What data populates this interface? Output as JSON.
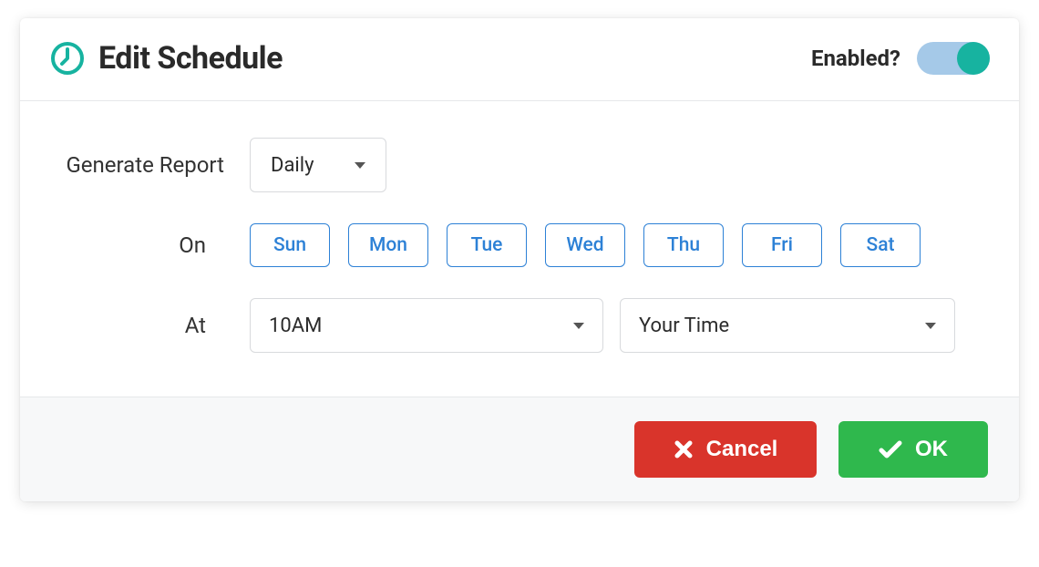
{
  "header": {
    "title": "Edit Schedule",
    "enabled_label": "Enabled?",
    "enabled": true
  },
  "body": {
    "generate_label": "Generate Report",
    "frequency_value": "Daily",
    "on_label": "On",
    "days": [
      "Sun",
      "Mon",
      "Tue",
      "Wed",
      "Thu",
      "Fri",
      "Sat"
    ],
    "at_label": "At",
    "time_value": "10AM",
    "tz_value": "Your Time"
  },
  "footer": {
    "cancel_label": "Cancel",
    "ok_label": "OK"
  },
  "colors": {
    "accent_teal": "#17b3a0",
    "day_border": "#2d81d6",
    "cancel_bg": "#d9342b",
    "ok_bg": "#2fb84d"
  }
}
